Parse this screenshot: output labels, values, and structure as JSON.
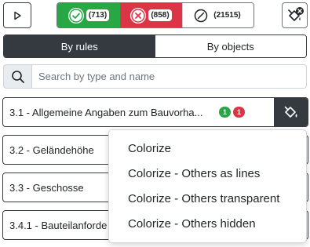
{
  "toolbar": {
    "play_icon": "play-icon",
    "passed_count": "(713)",
    "failed_count": "(858)",
    "na_count": "(21515)",
    "clear_colors_icon": "paint-bucket-x-icon"
  },
  "tabs": {
    "by_rules": "By rules",
    "by_objects": "By objects"
  },
  "search": {
    "placeholder": "Search by type and name",
    "value": ""
  },
  "rules": [
    {
      "label": "3.1 - Allgemeine Angaben zum Bauvorha...",
      "passed": "1",
      "failed": "1"
    },
    {
      "label": "3.2 - Geländehöhe"
    },
    {
      "label": "3.3 - Geschosse"
    },
    {
      "label": "3.4.1 - Bauteilanforde"
    }
  ],
  "colorize_menu": {
    "items": [
      "Colorize",
      "Colorize - Others as lines",
      "Colorize - Others transparent",
      "Colorize - Others hidden"
    ]
  },
  "colors": {
    "dark": "#343a40",
    "success": "#28a745",
    "danger": "#dc3545"
  }
}
